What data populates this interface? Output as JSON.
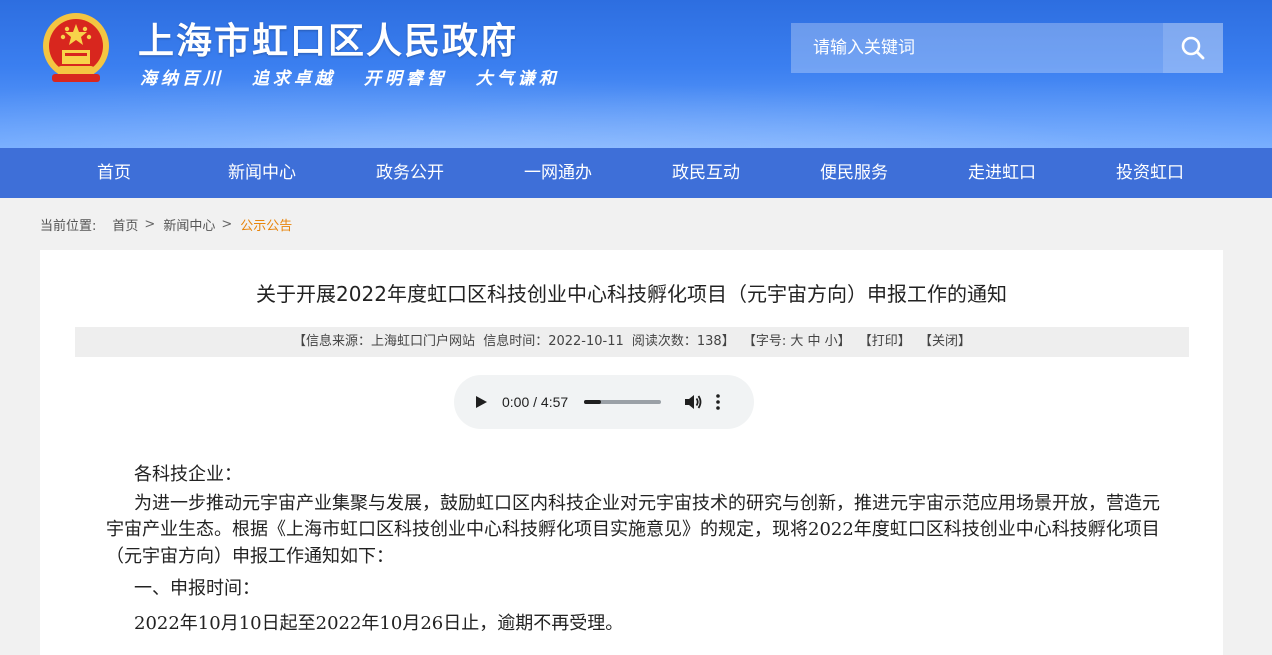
{
  "header": {
    "title": "上海市虹口区人民政府",
    "slogan": "海纳百川 追求卓越 开明睿智 大气谦和",
    "search": {
      "placeholder": "请输入关键词"
    }
  },
  "nav": {
    "items": [
      "首页",
      "新闻中心",
      "政务公开",
      "一网通办",
      "政民互动",
      "便民服务",
      "走进虹口",
      "投资虹口"
    ]
  },
  "breadcrumb": {
    "label": "当前位置:",
    "items": [
      "首页",
      "新闻中心",
      "公示公告"
    ],
    "sep": ">"
  },
  "article": {
    "title": "关于开展2022年度虹口区科技创业中心科技孵化项目（元宇宙方向）申报工作的通知",
    "meta": {
      "source": "【信息来源：上海虹口门户网站",
      "date": "信息时间：2022-10-11",
      "views": "阅读次数：138】",
      "font_size": "【字号: 大 中 小】",
      "print": "【打印】",
      "close": "【关闭】"
    },
    "audio": {
      "time": "0:00 / 4:57",
      "progress": 0.22
    },
    "salutation": "各科技企业：",
    "paragraph1": "为进一步推动元宇宙产业集聚与发展，鼓励虹口区内科技企业对元宇宙技术的研究与创新，推进元宇宙示范应用场景开放，营造元宇宙产业生态。根据《上海市虹口区科技创业中心科技孵化项目实施意见》的规定，现将2022年度虹口区科技创业中心科技孵化项目（元宇宙方向）申报工作通知如下：",
    "section1_heading": "一、申报时间：",
    "section1_body": "2022年10月10日起至2022年10月26日止，逾期不再受理。"
  },
  "colors": {
    "header_blue": "#3b7ff0",
    "nav_blue": "#3e6fd8",
    "breadcrumb_current": "#e8850c"
  }
}
